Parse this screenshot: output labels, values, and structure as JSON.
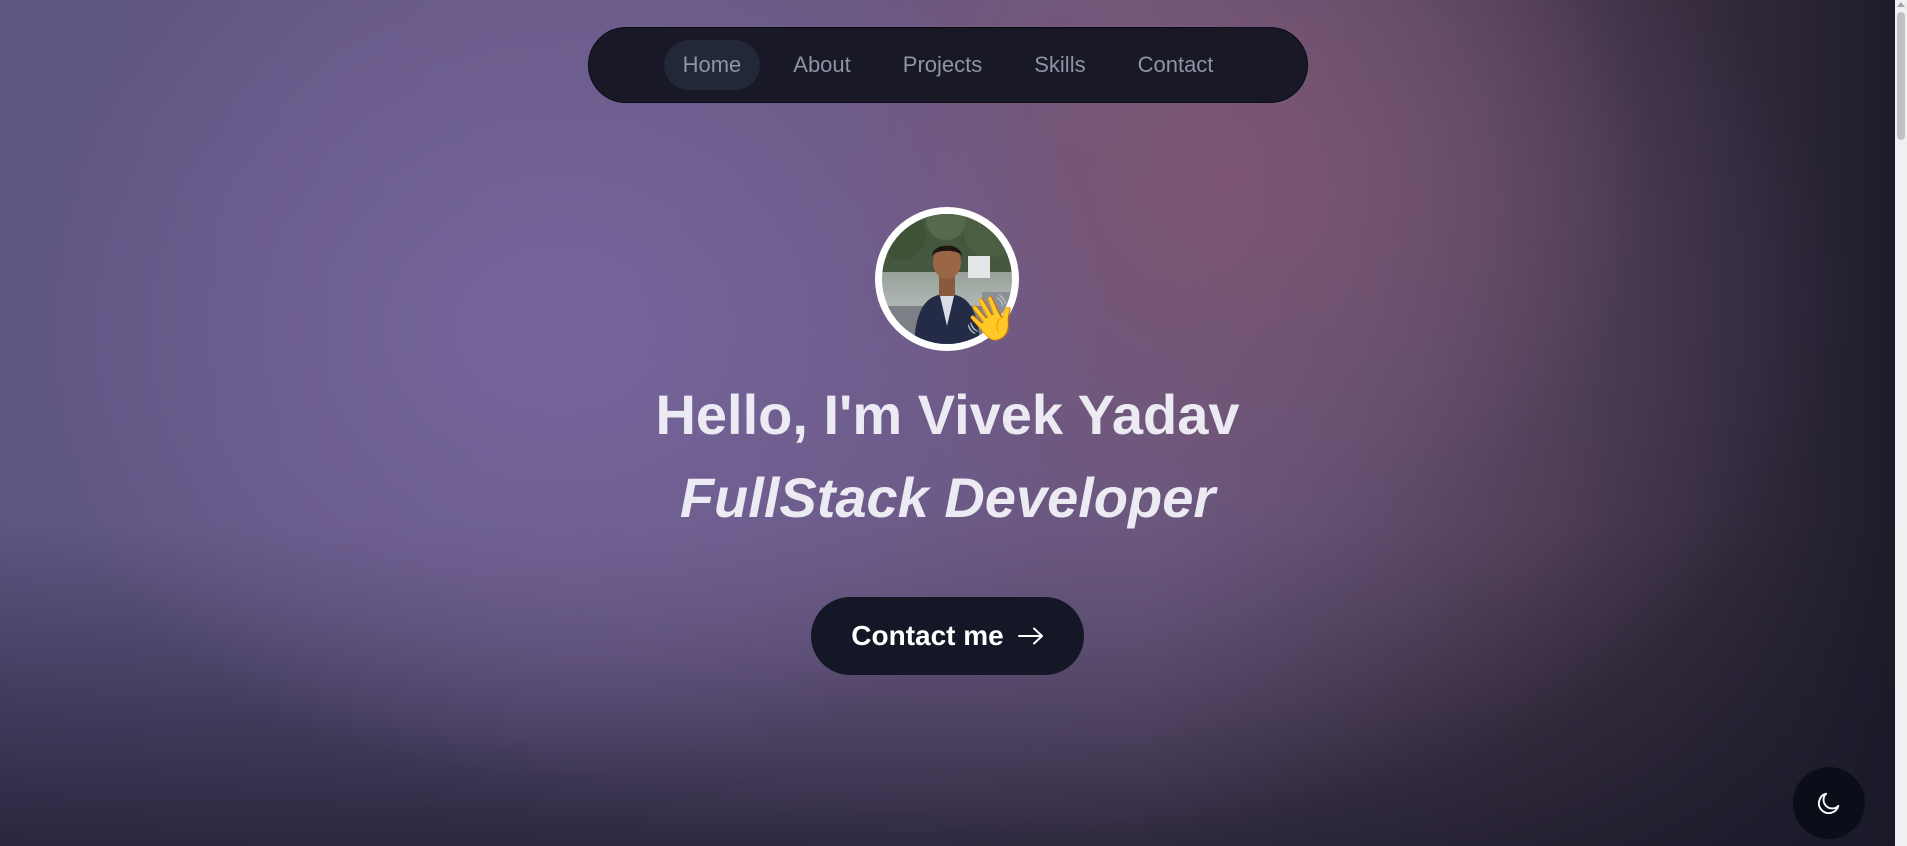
{
  "nav": {
    "items": [
      {
        "label": "Home",
        "active": true
      },
      {
        "label": "About",
        "active": false
      },
      {
        "label": "Projects",
        "active": false
      },
      {
        "label": "Skills",
        "active": false
      },
      {
        "label": "Contact",
        "active": false
      }
    ]
  },
  "hero": {
    "avatar_icon": "profile-photo",
    "wave_emoji": "👋",
    "title": "Hello, I'm Vivek Yadav",
    "subtitle": "FullStack Developer",
    "cta_label": "Contact me",
    "cta_icon": "arrow-right-icon"
  },
  "theme_toggle": {
    "icon": "moon-icon"
  },
  "colors": {
    "nav_bg": "#181827",
    "nav_active_bg": "#222837",
    "nav_text": "#8f93a3",
    "heading_text": "#eceaf3",
    "cta_bg": "#141826",
    "toggle_bg": "#0b0e18"
  }
}
